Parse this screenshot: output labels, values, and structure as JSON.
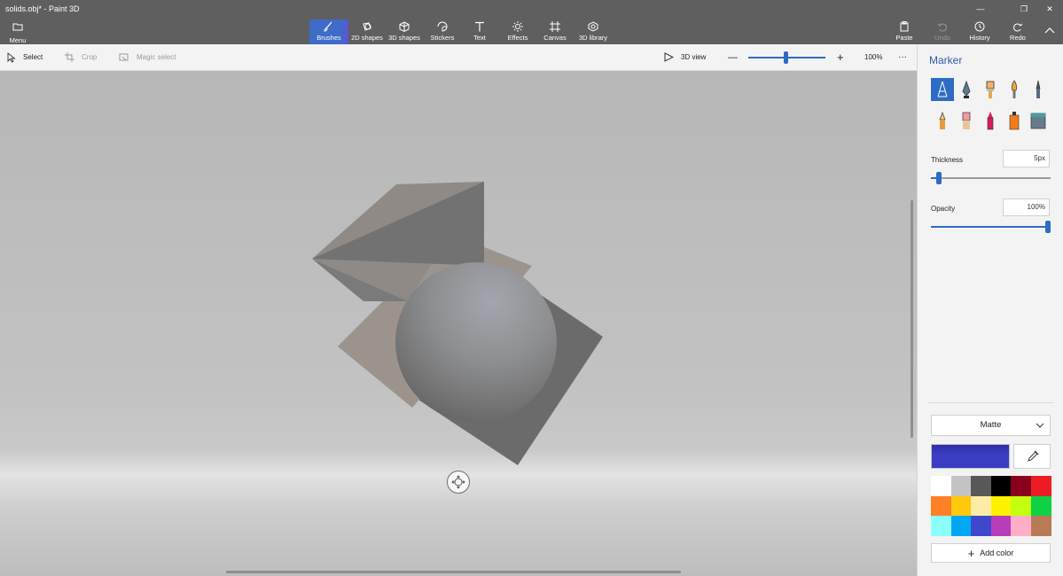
{
  "window": {
    "title": "solids.obj* - Paint 3D",
    "controls": {
      "minimize": "—",
      "maximize": "❐",
      "close": "✕"
    }
  },
  "ribbon": {
    "menu_label": "Menu",
    "tools": [
      {
        "label": "Brushes",
        "icon": "brush-icon",
        "active": true
      },
      {
        "label": "2D shapes",
        "icon": "2d-shapes-icon"
      },
      {
        "label": "3D shapes",
        "icon": "3d-shapes-icon"
      },
      {
        "label": "Stickers",
        "icon": "stickers-icon"
      },
      {
        "label": "Text",
        "icon": "text-icon"
      },
      {
        "label": "Effects",
        "icon": "effects-icon"
      },
      {
        "label": "Canvas",
        "icon": "canvas-icon"
      },
      {
        "label": "3D library",
        "icon": "3d-library-icon"
      }
    ],
    "right_tools": [
      {
        "label": "Paste",
        "icon": "paste-icon",
        "disabled": false
      },
      {
        "label": "Undo",
        "icon": "undo-icon",
        "disabled": true
      },
      {
        "label": "History",
        "icon": "history-icon",
        "disabled": false
      },
      {
        "label": "Redo",
        "icon": "redo-icon",
        "disabled": false
      }
    ]
  },
  "toolbar": {
    "select_label": "Select",
    "crop_label": "Crop",
    "magic_select_label": "Magic select",
    "view_3d_label": "3D view",
    "zoom_out": "—",
    "zoom_in": "+",
    "zoom_level": "100%",
    "zoom_fraction": 0.47,
    "more_label": "···"
  },
  "panel": {
    "title": "Marker",
    "brushes": [
      {
        "name": "marker",
        "active": true
      },
      {
        "name": "calligraphy-pen"
      },
      {
        "name": "oil-brush"
      },
      {
        "name": "watercolor"
      },
      {
        "name": "pixel-pen"
      },
      {
        "name": "pencil"
      },
      {
        "name": "eraser"
      },
      {
        "name": "crayon"
      },
      {
        "name": "spray-can"
      },
      {
        "name": "fill"
      }
    ],
    "thickness_label": "Thickness",
    "thickness_value": "5px",
    "thickness_fraction": 0.05,
    "opacity_label": "Opacity",
    "opacity_value": "100%",
    "opacity_fraction": 1.0,
    "finish": "Matte",
    "current_color": "#3b3ec4",
    "palette": [
      "#ffffff",
      "#c3c3c3",
      "#585858",
      "#000000",
      "#88001b",
      "#ec1c24",
      "#ff7f27",
      "#ffc90e",
      "#fdeca6",
      "#fff200",
      "#c4ff0e",
      "#0ed145",
      "#8cfffb",
      "#00a8f3",
      "#3f48cc",
      "#b83dba",
      "#ffaec8",
      "#b97a56"
    ],
    "add_color_label": "Add color",
    "accent": "#2e6bc4"
  }
}
